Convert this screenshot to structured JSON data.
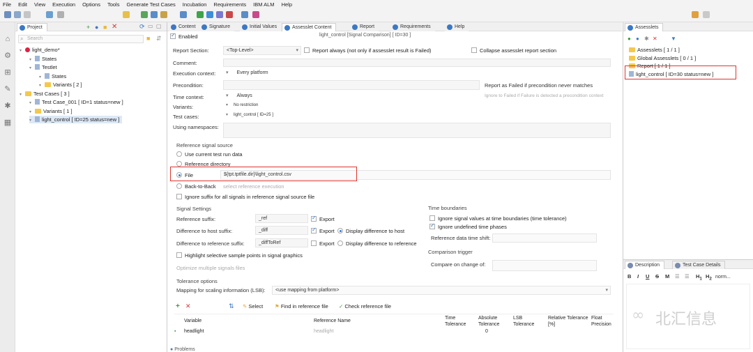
{
  "menu": [
    "File",
    "Edit",
    "View",
    "Execution",
    "Options",
    "Tools",
    "Generate Test Cases",
    "Incubation",
    "Requirements",
    "IBM ALM",
    "Help"
  ],
  "project_panel": {
    "tab_label": "Project",
    "search_placeholder": "Search",
    "tree": [
      {
        "label": "light_demo*",
        "level": 0,
        "icon": "red-dot"
      },
      {
        "label": "States",
        "level": 1,
        "icon": "file"
      },
      {
        "label": "Testlet",
        "level": 1,
        "icon": "file"
      },
      {
        "label": "States",
        "level": 2,
        "icon": "file"
      },
      {
        "label": "Variants  [ 2 ]",
        "level": 2,
        "icon": "folder"
      },
      {
        "label": "Test Cases  [ 3 ]",
        "level": 0,
        "icon": "folder"
      },
      {
        "label": "Test Case_001  [ ID=1 status=new ]",
        "level": 1,
        "icon": "file"
      },
      {
        "label": "Variants  [ 1 ]",
        "level": 1,
        "icon": "folder"
      },
      {
        "label": "light_control  [ ID=25 status=new ]",
        "level": 1,
        "icon": "file"
      }
    ]
  },
  "editor_tabs": [
    "Content",
    "Signature",
    "Initial Values",
    "Assesslet Content",
    "Report",
    "Requirements",
    "Help"
  ],
  "editor": {
    "window_title": "light_control [Signal Comparison] [ ID=30 ]",
    "enabled_label": "Enabled",
    "report_section_label": "Report Section:",
    "report_section_value": "<Top-Level>",
    "report_always": "Report always (not only if assesslet result is Failed)",
    "collapse_label": "Collapse assesslet report section",
    "comment_label": "Comment:",
    "execution_context_label": "Execution context:",
    "execution_context_value": "Every platform",
    "precondition_label": "Precondition:",
    "report_failed": "Report as Failed if precondition never matches",
    "ignore_faint": "Ignore to Failed if Failure is detected a precondition context",
    "time_context_label": "Time context:",
    "time_context_value": "Always",
    "variants_label": "Variants:",
    "variants_value": "No restriction",
    "test_cases_label": "Test cases:",
    "test_cases_value": "light_control [ ID=25 ]",
    "namespaces_label": "Using namespaces:",
    "ref_source_title": "Reference signal source",
    "opt_current": "Use current test run data",
    "opt_refdir": "Reference directory",
    "opt_file": "File",
    "file_value": "${tpt.tptfile.dir}\\light_control.csv",
    "opt_b2b": "Back-to-Back",
    "b2b_faint": "select reference execution",
    "ignore_suffix": "Ignore suffix for all signals in reference signal source file",
    "signal_settings_title": "Signal Settings",
    "ref_suffix_label": "Reference suffix:",
    "ref_suffix_value": "_ref",
    "export_label": "Export",
    "diff_host_label": "Difference to host suffix:",
    "diff_host_value": "_diff",
    "display_diff_host": "Display difference to host",
    "diff_ref_label": "Difference to reference suffix:",
    "diff_ref_value": "_diffToRef",
    "display_diff_ref": "Display difference to reference",
    "highlight_label": "Highlight selective sample points in signal graphics",
    "optimize_faint": "Optimize multiple signals files",
    "time_boundaries_title": "Time boundaries",
    "ignore_boundaries": "Ignore signal values at time boundaries (time tolerance)",
    "ignore_undefined": "Ignore undefined time phases",
    "ref_time_shift": "Reference data time shift:",
    "comparison_trigger_title": "Comparison trigger",
    "compare_on_change": "Compare on change of:",
    "tolerance_title": "Tolerance options",
    "mapping_label": "Mapping for scaling information (LSB):",
    "mapping_value": "<use mapping from platform>",
    "select_btn": "Select",
    "find_ref_btn": "Find in reference file",
    "check_ref_btn": "Check reference file",
    "columns": [
      "Variable",
      "Reference Name",
      "Time Tolerance",
      "Absolute Tolerance",
      "LSB Tolerance",
      "Relative Tolerance [%]",
      "Float Precision"
    ],
    "rows": [
      {
        "variable": "headlight",
        "reference": "headlight",
        "abs_tol": "0"
      }
    ],
    "problems_tab": "Problems"
  },
  "assesslets_panel": {
    "tab_label": "Assesslets",
    "items": [
      {
        "label": "Assesslets  [ 1 / 1 ]",
        "icon": "folder"
      },
      {
        "label": "Global Assesslets  [ 0 / 1 ]",
        "icon": "folder"
      },
      {
        "label": "Report  [ 1 / 1 ]",
        "icon": "folder"
      },
      {
        "label": "light_control  [ ID=30 status=new ]",
        "icon": "file"
      }
    ]
  },
  "description_panel": {
    "tab_description": "Description",
    "tab_details": "Test Case Details",
    "format_normal": "norm..."
  },
  "watermark": "北汇信息",
  "colors": {
    "highlight_box": "#e0332e",
    "accent": "#2a7ad8"
  }
}
